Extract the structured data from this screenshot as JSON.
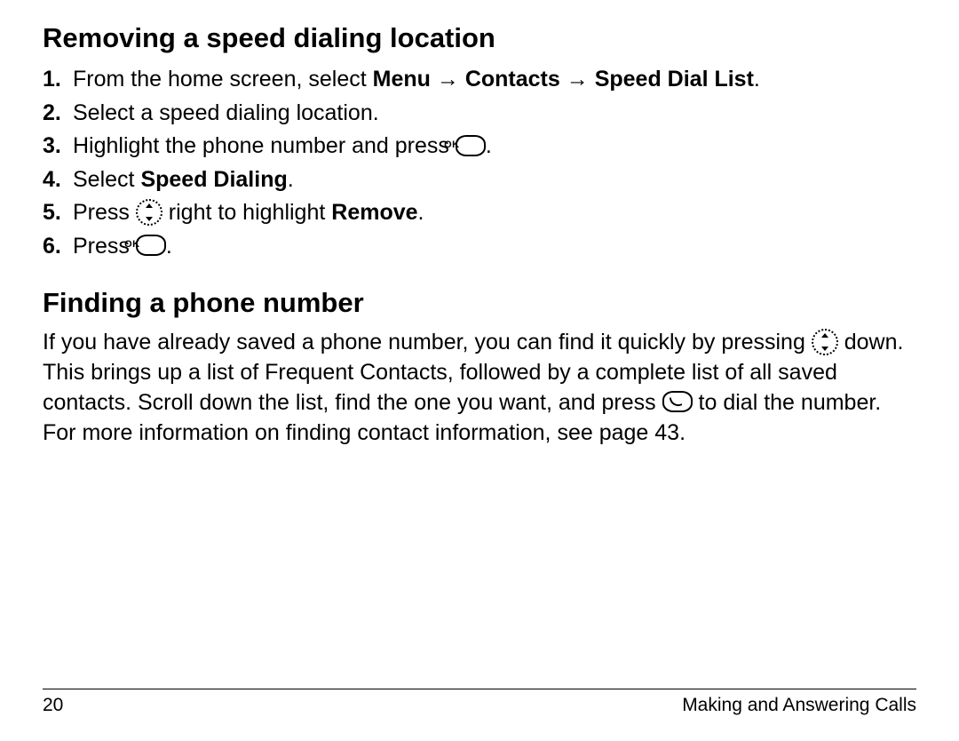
{
  "section1": {
    "heading": "Removing a speed dialing location",
    "steps": [
      {
        "num": "1.",
        "pre": "From the home screen, select ",
        "bold1": "Menu",
        "arr1": "→",
        "bold2": "Contacts",
        "arr2": "→",
        "bold3": "Speed Dial List",
        "post": "."
      },
      {
        "num": "2.",
        "text": "Select a speed dialing location."
      },
      {
        "num": "3.",
        "pre": "Highlight the phone number and press ",
        "post": "."
      },
      {
        "num": "4.",
        "pre": "Select ",
        "bold": "Speed Dialing",
        "post": "."
      },
      {
        "num": "5.",
        "pre": "Press ",
        "mid": " right to highlight ",
        "bold": "Remove",
        "post": "."
      },
      {
        "num": "6.",
        "pre": "Press ",
        "post": "."
      }
    ]
  },
  "section2": {
    "heading": "Finding a phone number",
    "para": {
      "t1": "If you have already saved a phone number, you can find it quickly by pressing ",
      "t2": " down. This brings up a list of Frequent Contacts, followed by a complete list of all saved contacts. Scroll down the list, find the one you want, and press ",
      "t3": " to dial the number. For more information on finding contact information, see page 43."
    }
  },
  "footer": {
    "page": "20",
    "title": "Making and Answering Calls"
  }
}
